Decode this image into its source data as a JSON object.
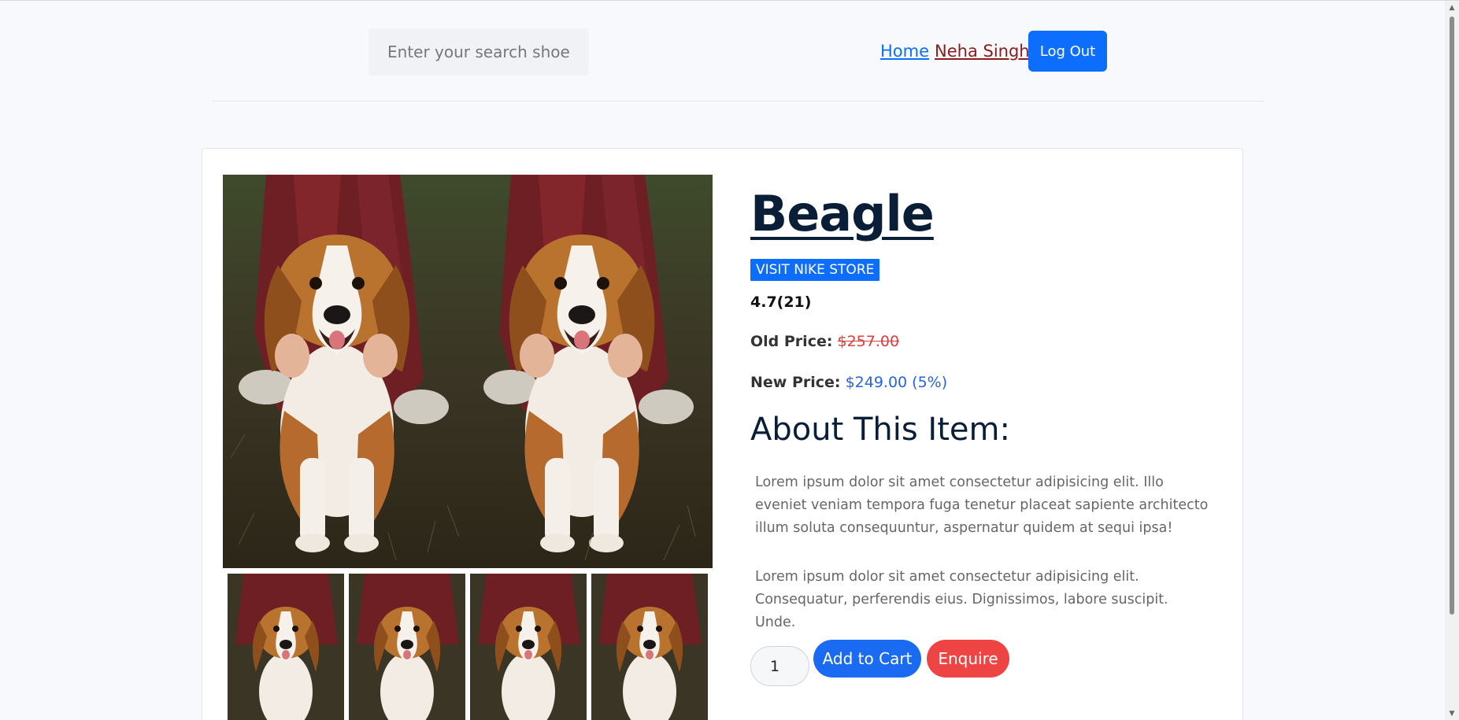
{
  "navbar": {
    "search_placeholder": "Enter your search shoes.",
    "home_label": "Home",
    "user_label": "Neha Singh",
    "logout_label": "Log Out"
  },
  "product": {
    "title": "Beagle",
    "store_badge": "VISIT NIKE STORE",
    "rating": "4.7(21)",
    "old_price_label": "Old Price:",
    "old_price": "$257.00",
    "new_price_label": "New Price:",
    "new_price": "$249.00 (5%)",
    "about_heading": "About This Item:",
    "paragraphs": [
      "Lorem ipsum dolor sit amet consectetur adipisicing elit. Illo eveniet veniam tempora fuga tenetur placeat sapiente architecto illum soluta consequuntur, aspernatur quidem at sequi ipsa!",
      "Lorem ipsum dolor sit amet consectetur adipisicing elit. Consequatur, perferendis eius. Dignissimos, labore suscipit. Unde."
    ],
    "quantity": "1",
    "add_to_cart_label": "Add to Cart",
    "enquire_label": "Enquire"
  },
  "colors": {
    "primary": "#0d6efd",
    "danger": "#ef4444",
    "title": "#0b1e38",
    "user_link": "#8a1c1c"
  },
  "icons": {
    "scroll_up": "chevron-up-icon",
    "scroll_down": "chevron-down-icon"
  }
}
